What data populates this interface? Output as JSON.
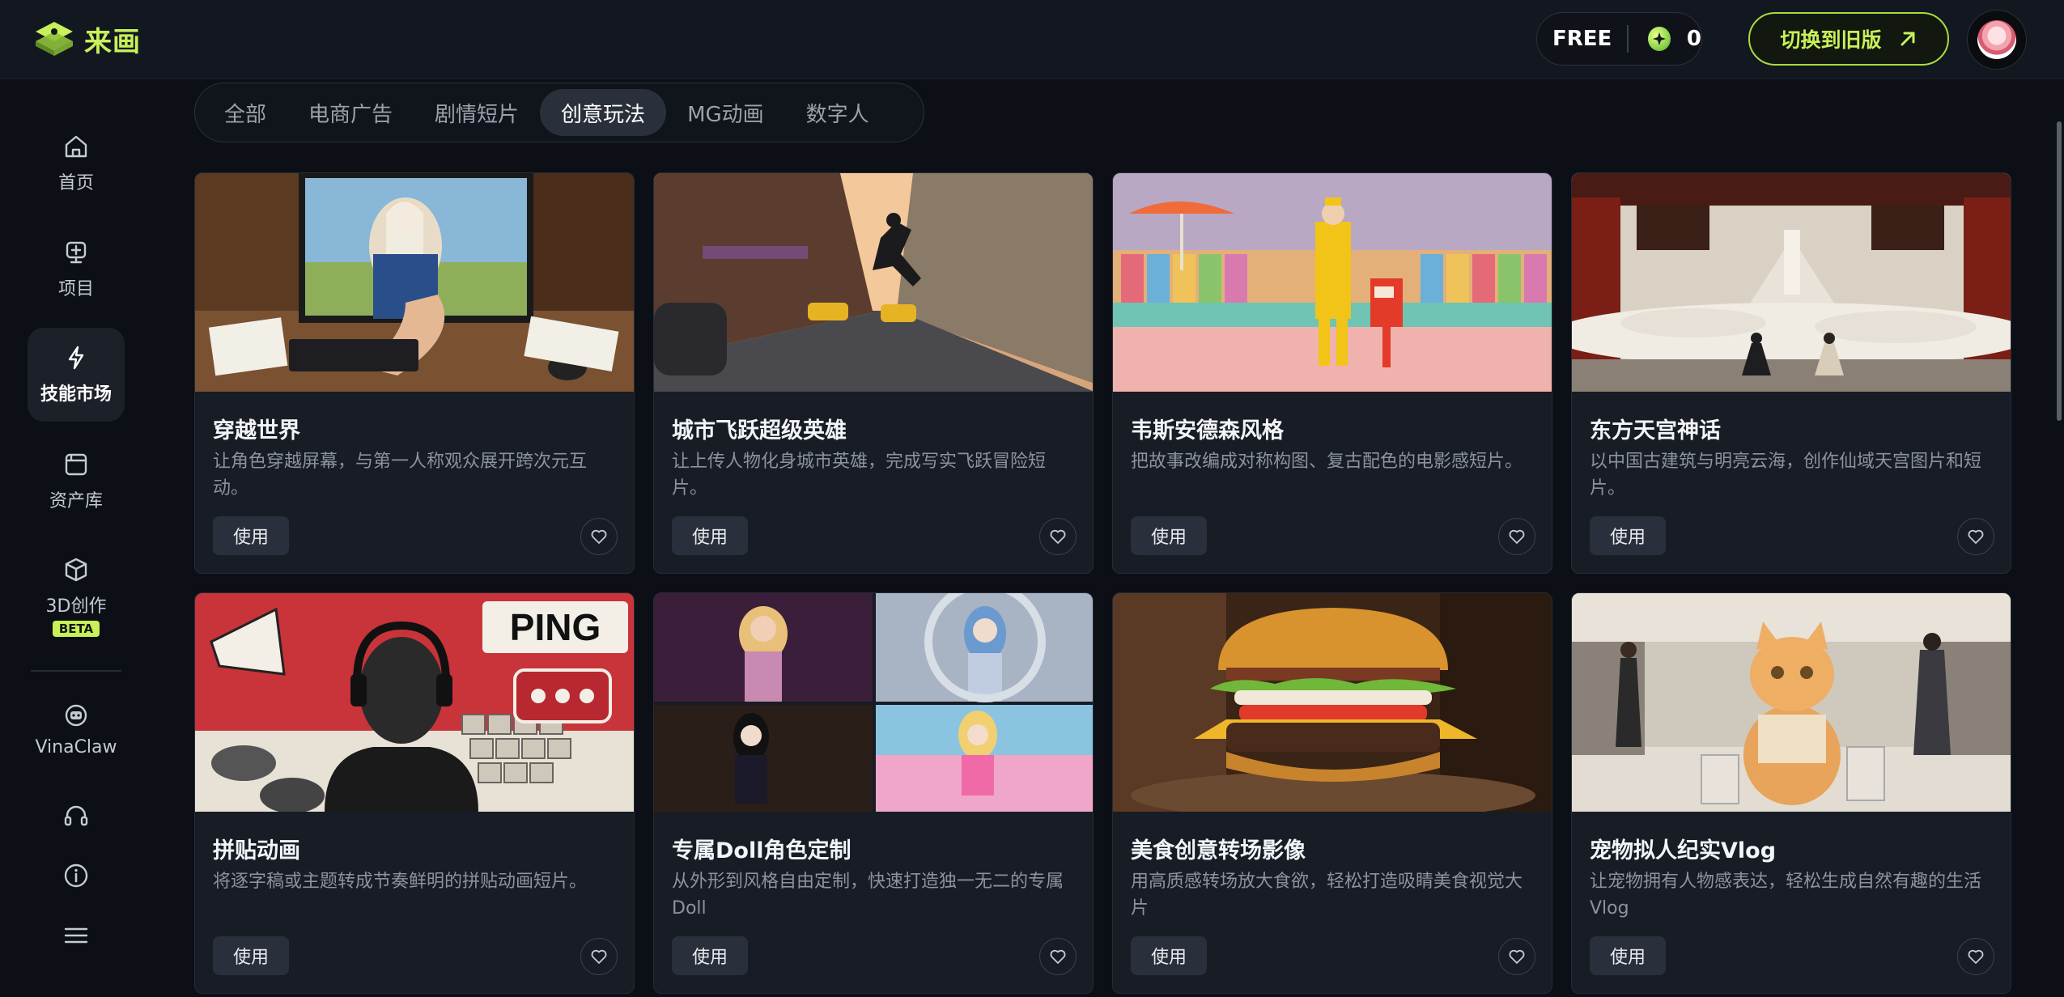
{
  "app": {
    "name": "来画",
    "brand_color": "#c7f05a"
  },
  "header": {
    "plan": "FREE",
    "credits": "0",
    "switch_label": "切换到旧版"
  },
  "sidebar": {
    "items": [
      {
        "label": "首页",
        "icon": "home-icon"
      },
      {
        "label": "项目",
        "icon": "project-icon"
      },
      {
        "label": "技能市场",
        "icon": "lightning-icon",
        "active": true
      },
      {
        "label": "资产库",
        "icon": "asset-library-icon"
      },
      {
        "label": "3D创作",
        "icon": "cube-icon",
        "badge": "BETA"
      },
      {
        "label": "VinaClaw",
        "icon": "bot-icon"
      }
    ],
    "bottom_icons": [
      "headset-icon",
      "info-icon",
      "menu-icon"
    ]
  },
  "tabs": [
    {
      "label": "全部"
    },
    {
      "label": "电商广告"
    },
    {
      "label": "剧情短片"
    },
    {
      "label": "创意玩法",
      "active": true
    },
    {
      "label": "MG动画"
    },
    {
      "label": "数字人"
    }
  ],
  "cards": [
    {
      "title": "穿越世界",
      "desc": "让角色穿越屏幕，与第一人称观众展开跨次元互动。",
      "use": "使用",
      "image": "handshake-through-monitor"
    },
    {
      "title": "城市飞跃超级英雄",
      "desc": "让上传人物化身城市英雄，完成写实飞跃冒险短片。",
      "use": "使用",
      "image": "city-street-superhero"
    },
    {
      "title": "韦斯安德森风格",
      "desc": "把故事改编成对称构图、复古配色的电影感短片。",
      "use": "使用",
      "image": "symmetric-pastel-scene"
    },
    {
      "title": "东方天宫神话",
      "desc": "以中国古建筑与明亮云海，创作仙域天宫图片和短片。",
      "use": "使用",
      "image": "heavenly-palace-clouds"
    },
    {
      "title": "拼贴动画",
      "desc": "将逐字稿或主题转成节奏鲜明的拼贴动画短片。",
      "use": "使用",
      "image": "collage-ping"
    },
    {
      "title": "专属Doll角色定制",
      "desc": "从外形到风格自由定制，快速打造独一无二的专属Doll",
      "use": "使用",
      "image": "doll-grid"
    },
    {
      "title": "美食创意转场影像",
      "desc": "用高质感转场放大食欲，轻松打造吸睛美食视觉大片",
      "use": "使用",
      "image": "burger-closeup"
    },
    {
      "title": "宠物拟人纪实Vlog",
      "desc": "让宠物拥有人物感表达，轻松生成自然有趣的生活Vlog",
      "use": "使用",
      "image": "cat-shopping-mall"
    }
  ],
  "collage": {
    "ping_text": "PING"
  }
}
